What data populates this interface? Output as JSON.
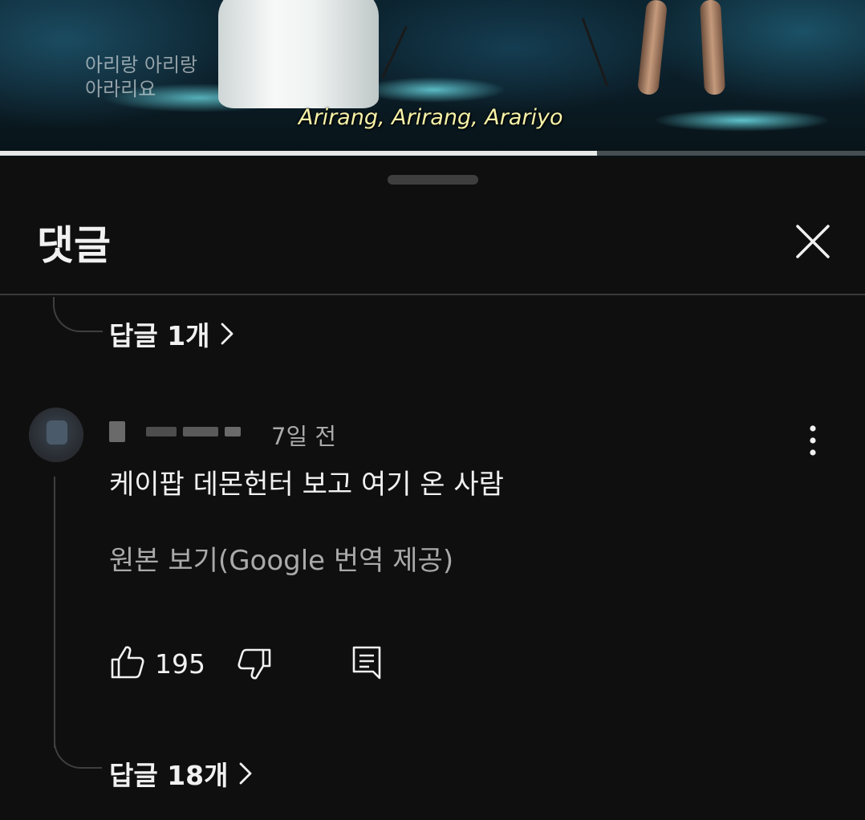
{
  "video": {
    "subtitle_ko": "아리랑 아리랑\n아라리요",
    "subtitle_en": "Arirang, Arirang, Arariyo",
    "progress": 0.69
  },
  "sheet": {
    "title": "댓글",
    "close_icon": "close-icon"
  },
  "previous_thread": {
    "replies_label": "답글 1개"
  },
  "comment": {
    "author": "",
    "time": "7일 전",
    "text": "케이팝 데몬헌터 보고 여기 온 사람",
    "translate_label": "원본 보기(Google 번역 제공)",
    "likes": "195",
    "replies_label": "답글 18개",
    "icons": [
      "thumbs-up-icon",
      "thumbs-down-icon",
      "reply-icon",
      "more-vert-icon",
      "chevron-right-icon"
    ]
  },
  "colors": {
    "background": "#0f0f0f",
    "text_primary": "#f1f1f1",
    "text_secondary": "#aaaaaa",
    "divider": "#3a3a3a"
  }
}
